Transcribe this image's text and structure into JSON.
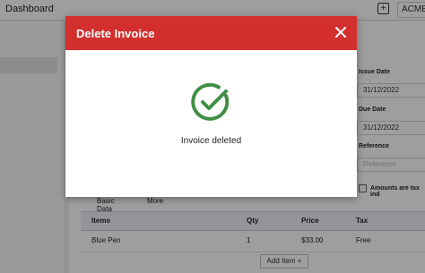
{
  "topbar": {
    "title": "Dashboard",
    "add_icon": "plus-square-icon",
    "company": "ACME"
  },
  "form": {
    "issue_date_label": "Issue Date",
    "issue_date_value": "31/12/2022",
    "due_date_label": "Due Date",
    "due_date_value": "31/12/2022",
    "reference_label": "Reference",
    "reference_placeholder": "Reference",
    "tax_inclusive_label": "Amounts are tax ind"
  },
  "tabs": [
    {
      "label": "Basic Data",
      "active": true
    },
    {
      "label": "More",
      "active": false
    }
  ],
  "table": {
    "columns": [
      "Items",
      "Qty",
      "Price",
      "Tax"
    ],
    "rows": [
      {
        "item": "Blue Pen",
        "qty": "1",
        "price": "$33.00",
        "tax": "Free"
      }
    ],
    "add_item_label": "Add Item +"
  },
  "dialog": {
    "title": "Delete Invoice",
    "message": "Invoice deleted",
    "close_icon": "close-icon",
    "status_icon": "check-circle-icon",
    "header_color": "#d32f2f",
    "success_color": "#3f8f45"
  }
}
